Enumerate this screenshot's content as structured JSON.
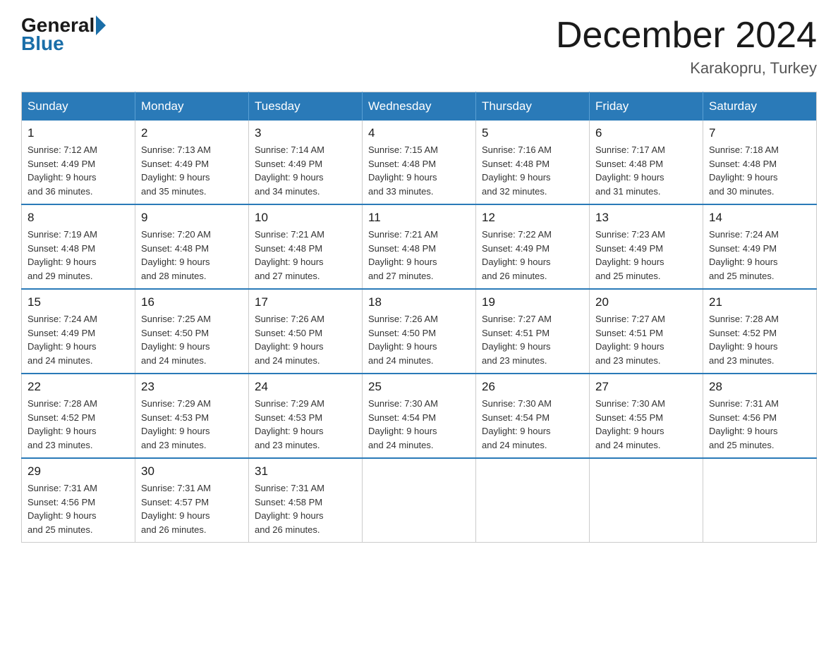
{
  "logo": {
    "general": "General",
    "blue": "Blue"
  },
  "title": "December 2024",
  "subtitle": "Karakopru, Turkey",
  "headers": [
    "Sunday",
    "Monday",
    "Tuesday",
    "Wednesday",
    "Thursday",
    "Friday",
    "Saturday"
  ],
  "weeks": [
    [
      {
        "day": "1",
        "sunrise": "7:12 AM",
        "sunset": "4:49 PM",
        "daylight": "9 hours and 36 minutes."
      },
      {
        "day": "2",
        "sunrise": "7:13 AM",
        "sunset": "4:49 PM",
        "daylight": "9 hours and 35 minutes."
      },
      {
        "day": "3",
        "sunrise": "7:14 AM",
        "sunset": "4:49 PM",
        "daylight": "9 hours and 34 minutes."
      },
      {
        "day": "4",
        "sunrise": "7:15 AM",
        "sunset": "4:48 PM",
        "daylight": "9 hours and 33 minutes."
      },
      {
        "day": "5",
        "sunrise": "7:16 AM",
        "sunset": "4:48 PM",
        "daylight": "9 hours and 32 minutes."
      },
      {
        "day": "6",
        "sunrise": "7:17 AM",
        "sunset": "4:48 PM",
        "daylight": "9 hours and 31 minutes."
      },
      {
        "day": "7",
        "sunrise": "7:18 AM",
        "sunset": "4:48 PM",
        "daylight": "9 hours and 30 minutes."
      }
    ],
    [
      {
        "day": "8",
        "sunrise": "7:19 AM",
        "sunset": "4:48 PM",
        "daylight": "9 hours and 29 minutes."
      },
      {
        "day": "9",
        "sunrise": "7:20 AM",
        "sunset": "4:48 PM",
        "daylight": "9 hours and 28 minutes."
      },
      {
        "day": "10",
        "sunrise": "7:21 AM",
        "sunset": "4:48 PM",
        "daylight": "9 hours and 27 minutes."
      },
      {
        "day": "11",
        "sunrise": "7:21 AM",
        "sunset": "4:48 PM",
        "daylight": "9 hours and 27 minutes."
      },
      {
        "day": "12",
        "sunrise": "7:22 AM",
        "sunset": "4:49 PM",
        "daylight": "9 hours and 26 minutes."
      },
      {
        "day": "13",
        "sunrise": "7:23 AM",
        "sunset": "4:49 PM",
        "daylight": "9 hours and 25 minutes."
      },
      {
        "day": "14",
        "sunrise": "7:24 AM",
        "sunset": "4:49 PM",
        "daylight": "9 hours and 25 minutes."
      }
    ],
    [
      {
        "day": "15",
        "sunrise": "7:24 AM",
        "sunset": "4:49 PM",
        "daylight": "9 hours and 24 minutes."
      },
      {
        "day": "16",
        "sunrise": "7:25 AM",
        "sunset": "4:50 PM",
        "daylight": "9 hours and 24 minutes."
      },
      {
        "day": "17",
        "sunrise": "7:26 AM",
        "sunset": "4:50 PM",
        "daylight": "9 hours and 24 minutes."
      },
      {
        "day": "18",
        "sunrise": "7:26 AM",
        "sunset": "4:50 PM",
        "daylight": "9 hours and 24 minutes."
      },
      {
        "day": "19",
        "sunrise": "7:27 AM",
        "sunset": "4:51 PM",
        "daylight": "9 hours and 23 minutes."
      },
      {
        "day": "20",
        "sunrise": "7:27 AM",
        "sunset": "4:51 PM",
        "daylight": "9 hours and 23 minutes."
      },
      {
        "day": "21",
        "sunrise": "7:28 AM",
        "sunset": "4:52 PM",
        "daylight": "9 hours and 23 minutes."
      }
    ],
    [
      {
        "day": "22",
        "sunrise": "7:28 AM",
        "sunset": "4:52 PM",
        "daylight": "9 hours and 23 minutes."
      },
      {
        "day": "23",
        "sunrise": "7:29 AM",
        "sunset": "4:53 PM",
        "daylight": "9 hours and 23 minutes."
      },
      {
        "day": "24",
        "sunrise": "7:29 AM",
        "sunset": "4:53 PM",
        "daylight": "9 hours and 23 minutes."
      },
      {
        "day": "25",
        "sunrise": "7:30 AM",
        "sunset": "4:54 PM",
        "daylight": "9 hours and 24 minutes."
      },
      {
        "day": "26",
        "sunrise": "7:30 AM",
        "sunset": "4:54 PM",
        "daylight": "9 hours and 24 minutes."
      },
      {
        "day": "27",
        "sunrise": "7:30 AM",
        "sunset": "4:55 PM",
        "daylight": "9 hours and 24 minutes."
      },
      {
        "day": "28",
        "sunrise": "7:31 AM",
        "sunset": "4:56 PM",
        "daylight": "9 hours and 25 minutes."
      }
    ],
    [
      {
        "day": "29",
        "sunrise": "7:31 AM",
        "sunset": "4:56 PM",
        "daylight": "9 hours and 25 minutes."
      },
      {
        "day": "30",
        "sunrise": "7:31 AM",
        "sunset": "4:57 PM",
        "daylight": "9 hours and 26 minutes."
      },
      {
        "day": "31",
        "sunrise": "7:31 AM",
        "sunset": "4:58 PM",
        "daylight": "9 hours and 26 minutes."
      },
      null,
      null,
      null,
      null
    ]
  ],
  "labels": {
    "sunrise": "Sunrise:",
    "sunset": "Sunset:",
    "daylight": "Daylight:"
  }
}
